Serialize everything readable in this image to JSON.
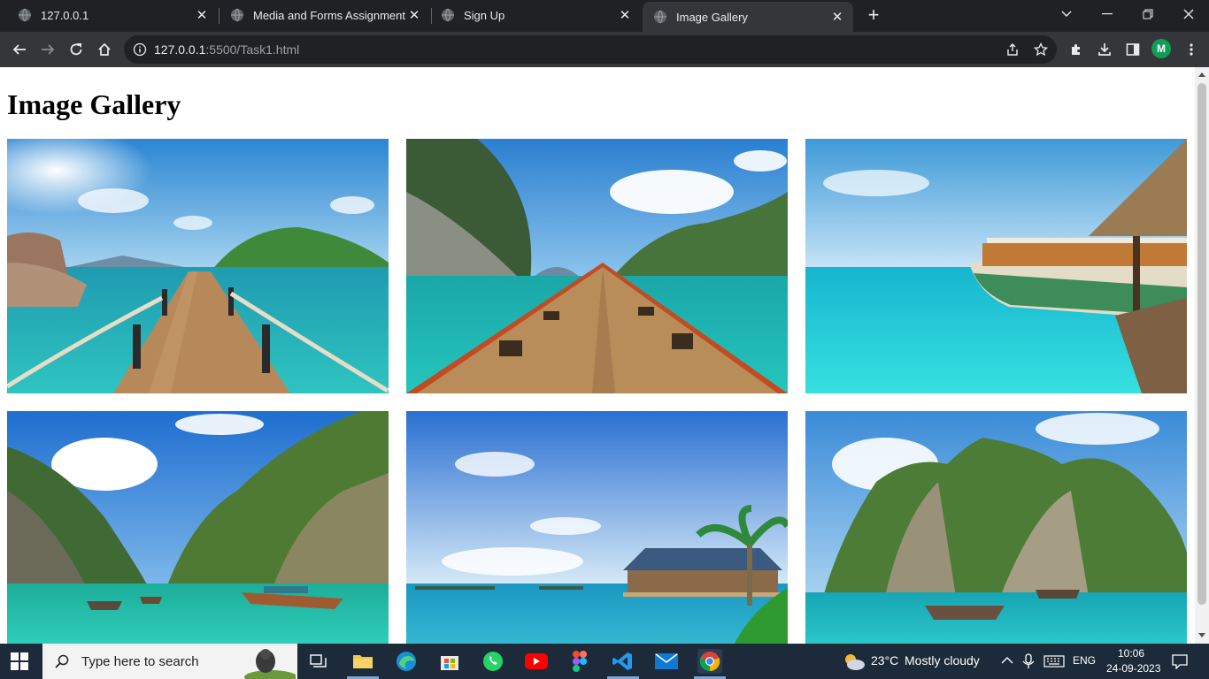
{
  "browser": {
    "tabs": [
      {
        "title": "127.0.0.1",
        "active": false
      },
      {
        "title": "Media and Forms Assignment.pdf",
        "active": false
      },
      {
        "title": "Sign Up",
        "active": false
      },
      {
        "title": "Image Gallery",
        "active": true
      }
    ],
    "url_host": "127.0.0.1",
    "url_rest": ":5500/Task1.html",
    "profile_initial": "M"
  },
  "page": {
    "title": "Image Gallery",
    "images": [
      {
        "subject": "wooden pier over turquoise sea"
      },
      {
        "subject": "longtail boat bow between limestone cliffs"
      },
      {
        "subject": "moored boat on bright turquoise water"
      },
      {
        "subject": "bay with boats under green cliffs"
      },
      {
        "subject": "overwater restaurant with palm tree"
      },
      {
        "subject": "longtail boats below limestone island"
      }
    ]
  },
  "taskbar": {
    "search_placeholder": "Type here to search",
    "weather_temp": "23°C",
    "weather_desc": "Mostly cloudy",
    "language": "ENG",
    "time": "10:06",
    "date": "24-09-2023"
  },
  "colors": {
    "chrome_dark": "#202124",
    "toolbar": "#35363a",
    "sea": "#1fc7c4",
    "sky": "#2f8fd6",
    "taskbar": "#1c2a3a"
  }
}
